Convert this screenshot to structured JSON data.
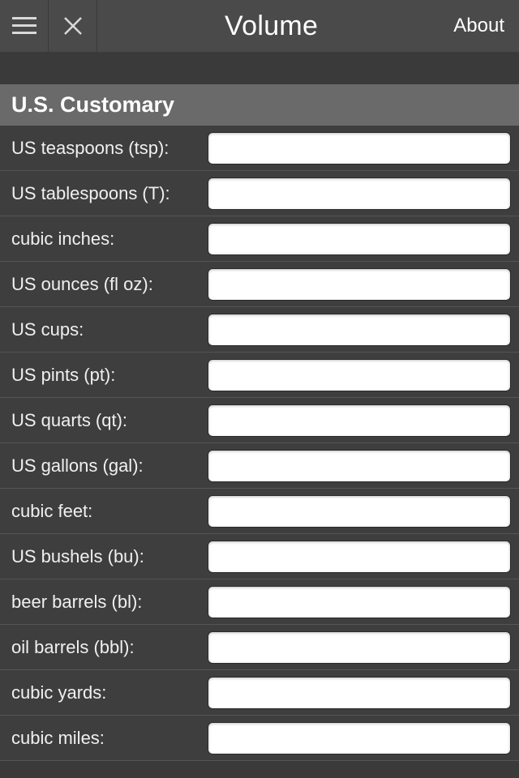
{
  "header": {
    "title": "Volume",
    "about_label": "About"
  },
  "section": {
    "title": "U.S. Customary"
  },
  "rows": [
    {
      "label": "US teaspoons (tsp):",
      "value": ""
    },
    {
      "label": "US tablespoons (T):",
      "value": ""
    },
    {
      "label": "cubic inches:",
      "value": ""
    },
    {
      "label": "US ounces (fl oz):",
      "value": ""
    },
    {
      "label": "US cups:",
      "value": ""
    },
    {
      "label": "US pints (pt):",
      "value": ""
    },
    {
      "label": "US quarts (qt):",
      "value": ""
    },
    {
      "label": "US gallons (gal):",
      "value": ""
    },
    {
      "label": "cubic feet:",
      "value": ""
    },
    {
      "label": "US bushels (bu):",
      "value": ""
    },
    {
      "label": "beer barrels (bl):",
      "value": ""
    },
    {
      "label": "oil barrels (bbl):",
      "value": ""
    },
    {
      "label": "cubic yards:",
      "value": ""
    },
    {
      "label": "cubic miles:",
      "value": ""
    }
  ]
}
